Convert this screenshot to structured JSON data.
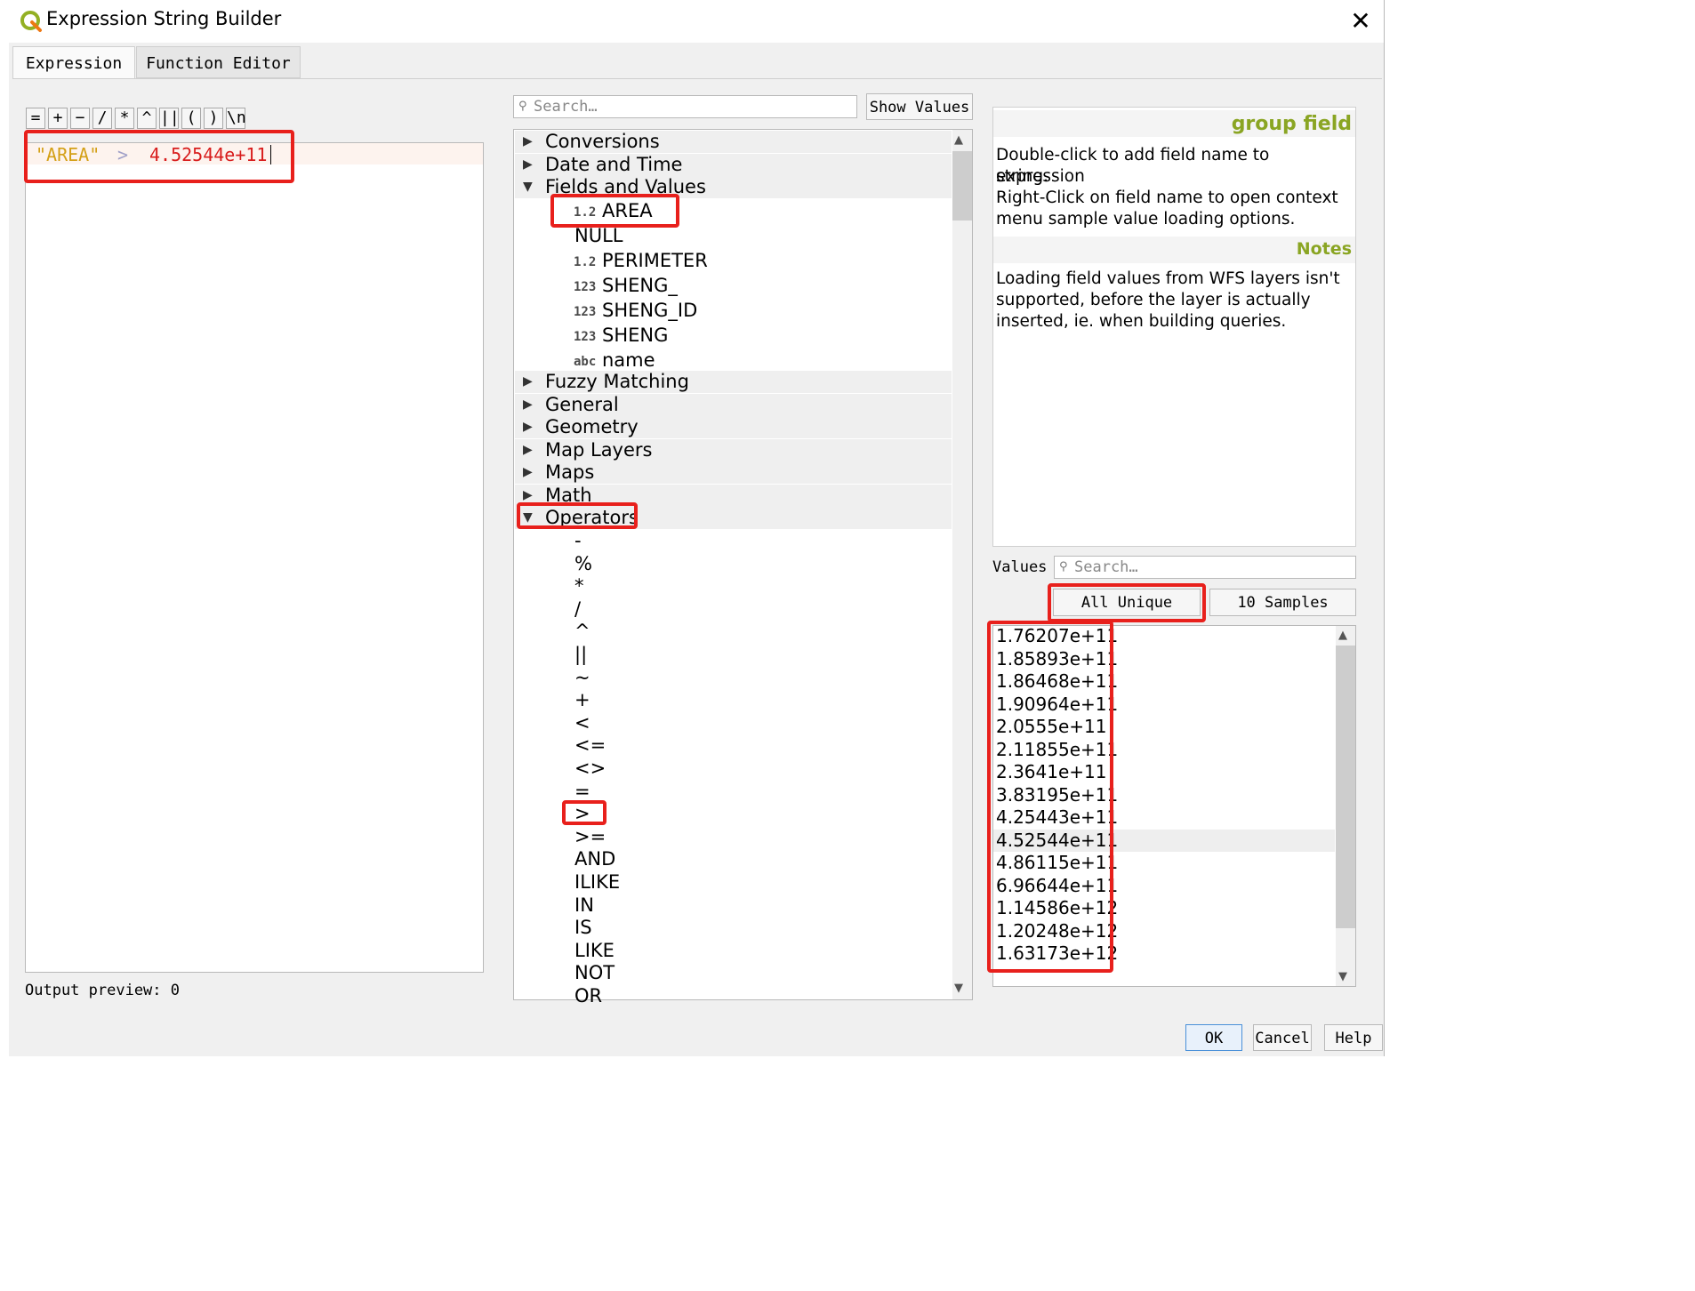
{
  "window": {
    "title": "Expression String Builder",
    "close_glyph": "✕"
  },
  "tabs": [
    {
      "label": "Expression"
    },
    {
      "label": "Function Editor"
    }
  ],
  "operator_buttons": [
    "=",
    "+",
    "−",
    "/",
    "*",
    "^",
    "||",
    "(",
    ")",
    "\\n"
  ],
  "editor": {
    "field": "\"AREA\"",
    "operator": ">",
    "value": "4.52544e+11"
  },
  "output_preview": "Output preview:  0",
  "function_search": {
    "placeholder": "Search…"
  },
  "show_values_label": "Show Values",
  "tree": {
    "groups_top": [
      "Conversions",
      "Date and Time",
      "Fields and Values"
    ],
    "fields": [
      {
        "tag": "1.2",
        "name": "AREA"
      },
      {
        "tag": "",
        "name": "NULL"
      },
      {
        "tag": "1.2",
        "name": "PERIMETER"
      },
      {
        "tag": "123",
        "name": "SHENG_"
      },
      {
        "tag": "123",
        "name": "SHENG_ID"
      },
      {
        "tag": "123",
        "name": "SHENG"
      },
      {
        "tag": "abc",
        "name": "name"
      }
    ],
    "groups_mid": [
      "Fuzzy Matching",
      "General",
      "Geometry",
      "Map Layers",
      "Maps",
      "Math",
      "Operators"
    ],
    "operators": [
      "-",
      "%",
      "*",
      "/",
      "^",
      "||",
      "~",
      "+",
      "<",
      "<=",
      "<>",
      "=",
      ">",
      ">=",
      "AND",
      "ILIKE",
      "IN",
      "IS",
      "LIKE",
      "NOT",
      "OR"
    ]
  },
  "help": {
    "title": "group field",
    "body": [
      "Double-click to add field name to expression",
      "string.",
      "Right-Click on field name to open context",
      "menu sample value loading options."
    ],
    "notes_title": "Notes",
    "notes": [
      "Loading field values from WFS layers isn't",
      "supported, before the layer is actually",
      "inserted, ie. when building queries."
    ]
  },
  "values_panel": {
    "label": "Values",
    "search_placeholder": "Search…",
    "all_unique_label": "All Unique",
    "samples_label": "10 Samples",
    "items": [
      "1.76207e+11",
      "1.85893e+11",
      "1.86468e+11",
      "1.90964e+11",
      "2.0555e+11",
      "2.11855e+11",
      "2.3641e+11",
      "3.83195e+11",
      "4.25443e+11",
      "4.52544e+11",
      "4.86115e+11",
      "6.96644e+11",
      "1.14586e+12",
      "1.20248e+12",
      "1.63173e+12"
    ],
    "selected": "4.52544e+11"
  },
  "dialog_buttons": {
    "ok": "OK",
    "cancel": "Cancel",
    "help": "Help"
  },
  "colors": {
    "accent_green": "#8aa523",
    "annotation_red": "#e8201c",
    "expr_field": "#d4a017",
    "expr_number": "#d81c1c"
  }
}
